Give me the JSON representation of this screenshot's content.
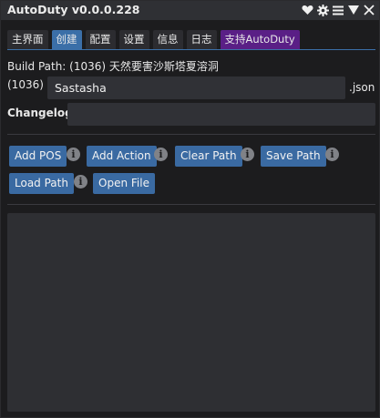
{
  "window": {
    "title": "AutoDuty v0.0.0.228",
    "icons": [
      "heart-icon",
      "gear-icon",
      "menu-icon",
      "collapse-triangle-icon",
      "close-icon"
    ]
  },
  "tabs": [
    {
      "label": "主界面",
      "active": false
    },
    {
      "label": "创建",
      "active": true
    },
    {
      "label": "配置",
      "active": false
    },
    {
      "label": "设置",
      "active": false
    },
    {
      "label": "信息",
      "active": false
    },
    {
      "label": "日志",
      "active": false
    },
    {
      "label": "支持AutoDuty",
      "active": false,
      "accent": "#5a1f86"
    }
  ],
  "build": {
    "path_label": "Build Path: (1036) 天然要害沙斯塔夏溶洞",
    "id_prefix": "(1036)",
    "file_name": "Sastasha",
    "extension": ".json",
    "changelog_label": "Changelog:",
    "changelog_value": ""
  },
  "buttons": {
    "add_pos": "Add POS",
    "add_action": "Add Action",
    "clear_path": "Clear Path",
    "save_path": "Save Path",
    "load_path": "Load Path",
    "open_file": "Open File",
    "info_glyph": "i"
  },
  "colors": {
    "accent": "#3a6aa2",
    "support_tab": "#5a1f86",
    "background": "#1c1c1e",
    "titlebar": "#2f3034",
    "input": "#303136"
  }
}
